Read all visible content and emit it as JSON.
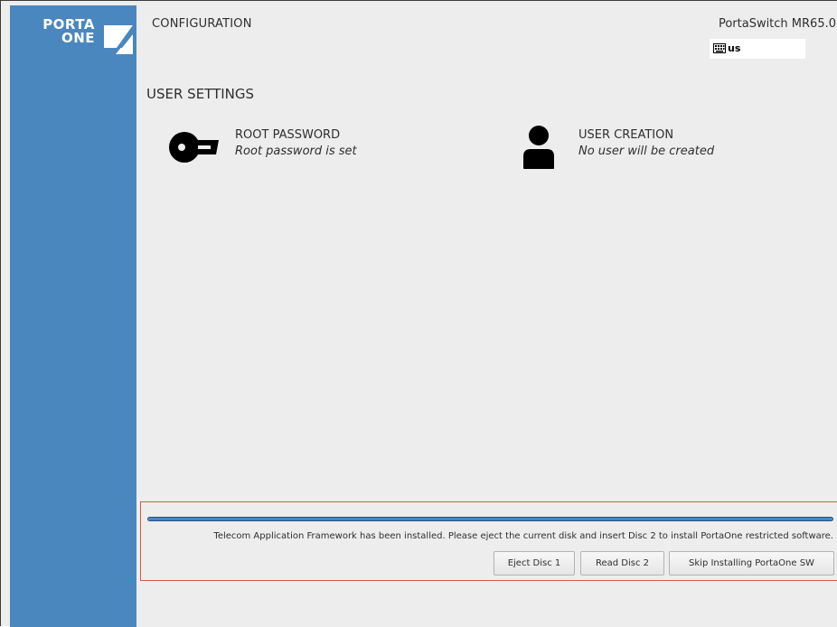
{
  "brand": {
    "logo_line1": "PORTA",
    "logo_line2": "ONE"
  },
  "header": {
    "title": "CONFIGURATION",
    "product": "PortaSwitch MR65.0",
    "keyboard_layout": "us"
  },
  "section": {
    "title": "USER SETTINGS"
  },
  "spokes": [
    {
      "title": "ROOT PASSWORD",
      "status": "Root password is set",
      "icon": "key-icon"
    },
    {
      "title": "USER CREATION",
      "status": "No user will be created",
      "icon": "user-icon"
    }
  ],
  "install": {
    "progress": 1.0,
    "message": "Telecom Application Framework has been installed. Please eject the current disk and insert Disc 2 to install PortaOne restricted software.",
    "buttons": {
      "eject": "Eject Disc 1",
      "read": "Read Disc 2",
      "skip": "Skip Installing PortaOne SW"
    }
  },
  "colors": {
    "sidebar": "#4a87be",
    "background": "#ededed",
    "highlight_border": "#d25b48",
    "progress": "#4a87be"
  }
}
